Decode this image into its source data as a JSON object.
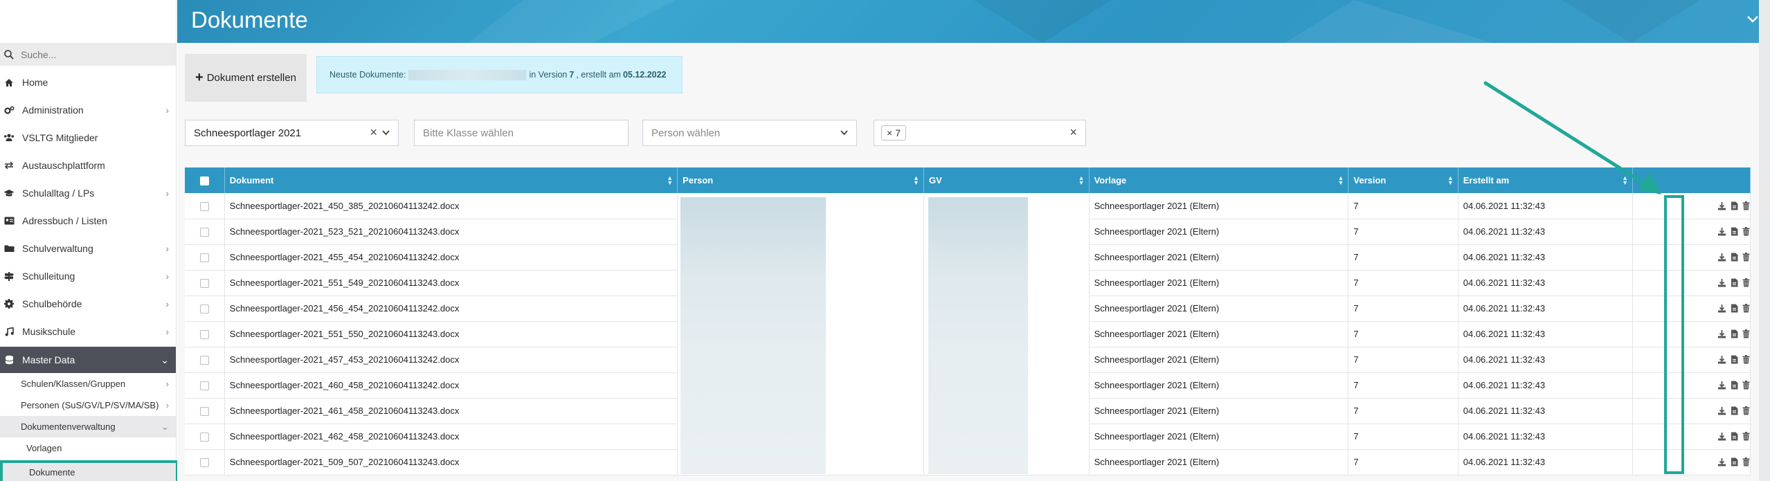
{
  "header": {
    "title": "Dokumente"
  },
  "sidebar": {
    "search_placeholder": "Suche...",
    "items": [
      {
        "label": "Home",
        "icon": "home-icon",
        "chevron": false
      },
      {
        "label": "Administration",
        "icon": "gears-icon",
        "chevron": true
      },
      {
        "label": "VSLTG Mitglieder",
        "icon": "users-icon",
        "chevron": false
      },
      {
        "label": "Austauschplattform",
        "icon": "exchange-icon",
        "chevron": false
      },
      {
        "label": "Schulalltag / LPs",
        "icon": "graduation-cap-icon",
        "chevron": true
      },
      {
        "label": "Adressbuch / Listen",
        "icon": "address-card-icon",
        "chevron": false
      },
      {
        "label": "Schulverwaltung",
        "icon": "folder-icon",
        "chevron": true
      },
      {
        "label": "Schulleitung",
        "icon": "signpost-icon",
        "chevron": true
      },
      {
        "label": "Schulbehörde",
        "icon": "cog-icon",
        "chevron": true
      },
      {
        "label": "Musikschule",
        "icon": "music-icon",
        "chevron": true
      }
    ],
    "active": {
      "label": "Master Data",
      "icon": "database-icon"
    },
    "sub_items": [
      {
        "label": "Schulen/Klassen/Gruppen"
      },
      {
        "label": "Personen (SuS/GV/LP/SV/MA/SB)"
      },
      {
        "label": "Dokumentenverwaltung"
      }
    ],
    "leaf_items": [
      {
        "label": "Vorlagen"
      },
      {
        "label": "Dokumente"
      }
    ]
  },
  "toolbar": {
    "create_label": "Dokument erstellen",
    "notice_prefix": "Neuste Dokumente:",
    "notice_mid": "in Version",
    "notice_version": "7",
    "notice_created": ", erstellt am",
    "notice_date": "05.12.2022"
  },
  "filters": {
    "lager": "Schneesportlager 2021",
    "klasse_placeholder": "Bitte Klasse wählen",
    "person_placeholder": "Person wählen",
    "version_tag": "7"
  },
  "table": {
    "columns": [
      "Dokument",
      "Person",
      "GV",
      "Vorlage",
      "Version",
      "Erstellt am"
    ],
    "rows": [
      {
        "dokument": "Schneesportlager-2021_450_385_20210604113242.docx",
        "vorlage": "Schneesportlager 2021 (Eltern)",
        "version": "7",
        "erstellt": "04.06.2021 11:32:43"
      },
      {
        "dokument": "Schneesportlager-2021_523_521_20210604113243.docx",
        "vorlage": "Schneesportlager 2021 (Eltern)",
        "version": "7",
        "erstellt": "04.06.2021 11:32:43"
      },
      {
        "dokument": "Schneesportlager-2021_455_454_20210604113242.docx",
        "vorlage": "Schneesportlager 2021 (Eltern)",
        "version": "7",
        "erstellt": "04.06.2021 11:32:43"
      },
      {
        "dokument": "Schneesportlager-2021_551_549_20210604113243.docx",
        "vorlage": "Schneesportlager 2021 (Eltern)",
        "version": "7",
        "erstellt": "04.06.2021 11:32:43"
      },
      {
        "dokument": "Schneesportlager-2021_456_454_20210604113242.docx",
        "vorlage": "Schneesportlager 2021 (Eltern)",
        "version": "7",
        "erstellt": "04.06.2021 11:32:43"
      },
      {
        "dokument": "Schneesportlager-2021_551_550_20210604113243.docx",
        "vorlage": "Schneesportlager 2021 (Eltern)",
        "version": "7",
        "erstellt": "04.06.2021 11:32:43"
      },
      {
        "dokument": "Schneesportlager-2021_457_453_20210604113242.docx",
        "vorlage": "Schneesportlager 2021 (Eltern)",
        "version": "7",
        "erstellt": "04.06.2021 11:32:43"
      },
      {
        "dokument": "Schneesportlager-2021_460_458_20210604113242.docx",
        "vorlage": "Schneesportlager 2021 (Eltern)",
        "version": "7",
        "erstellt": "04.06.2021 11:32:43"
      },
      {
        "dokument": "Schneesportlager-2021_461_458_20210604113243.docx",
        "vorlage": "Schneesportlager 2021 (Eltern)",
        "version": "7",
        "erstellt": "04.06.2021 11:32:43"
      },
      {
        "dokument": "Schneesportlager-2021_462_458_20210604113243.docx",
        "vorlage": "Schneesportlager 2021 (Eltern)",
        "version": "7",
        "erstellt": "04.06.2021 11:32:43"
      },
      {
        "dokument": "Schneesportlager-2021_509_507_20210604113243.docx",
        "vorlage": "Schneesportlager 2021 (Eltern)",
        "version": "7",
        "erstellt": "04.06.2021 11:32:43"
      }
    ]
  },
  "colors": {
    "header": "#2f97c4",
    "highlight": "#20a897",
    "sidebar_active": "#4d5058",
    "notice_bg": "#d2f2fc"
  }
}
